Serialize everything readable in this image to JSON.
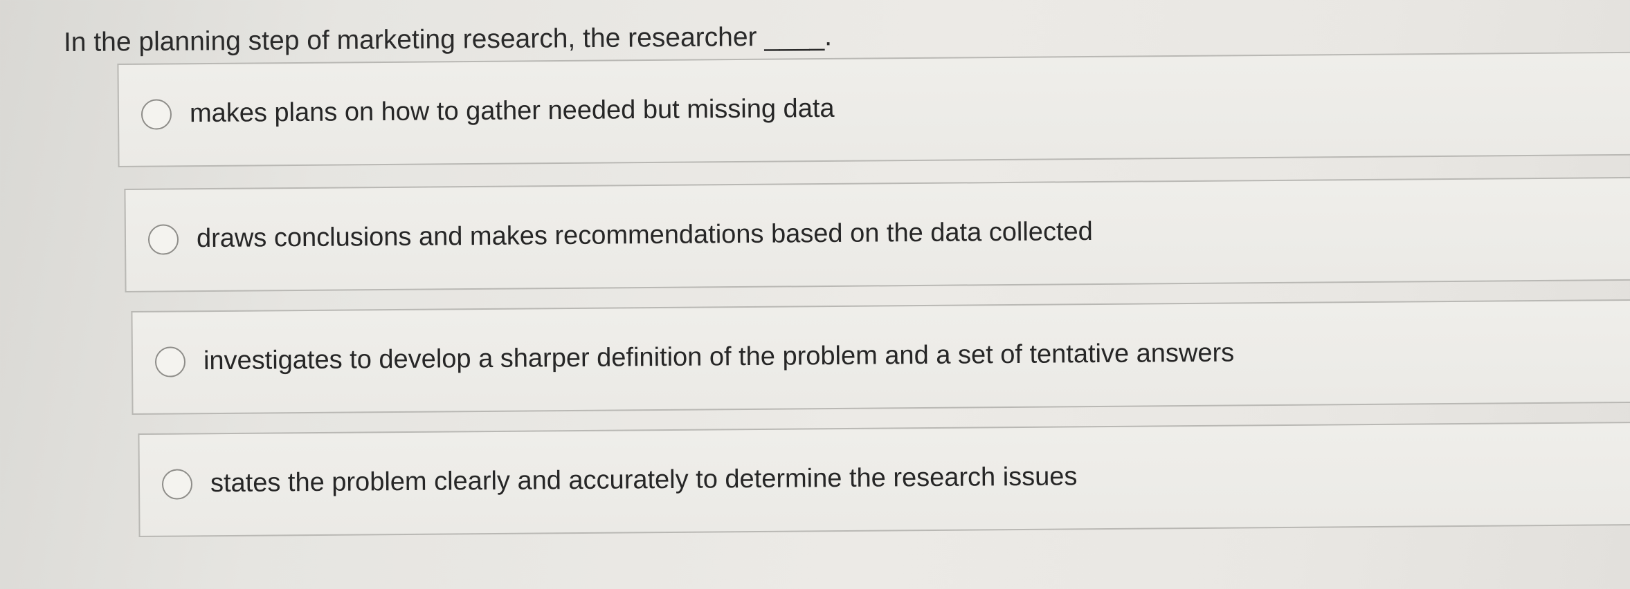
{
  "question": {
    "text": "In the planning step of marketing research, the researcher ____."
  },
  "options": [
    {
      "label": "makes plans on how to gather needed but missing data"
    },
    {
      "label": "draws conclusions and makes recommendations based on the data collected"
    },
    {
      "label": "investigates to develop a sharper definition of the problem and a set of tentative answers"
    },
    {
      "label": "states the problem clearly and accurately to determine the research issues"
    }
  ]
}
